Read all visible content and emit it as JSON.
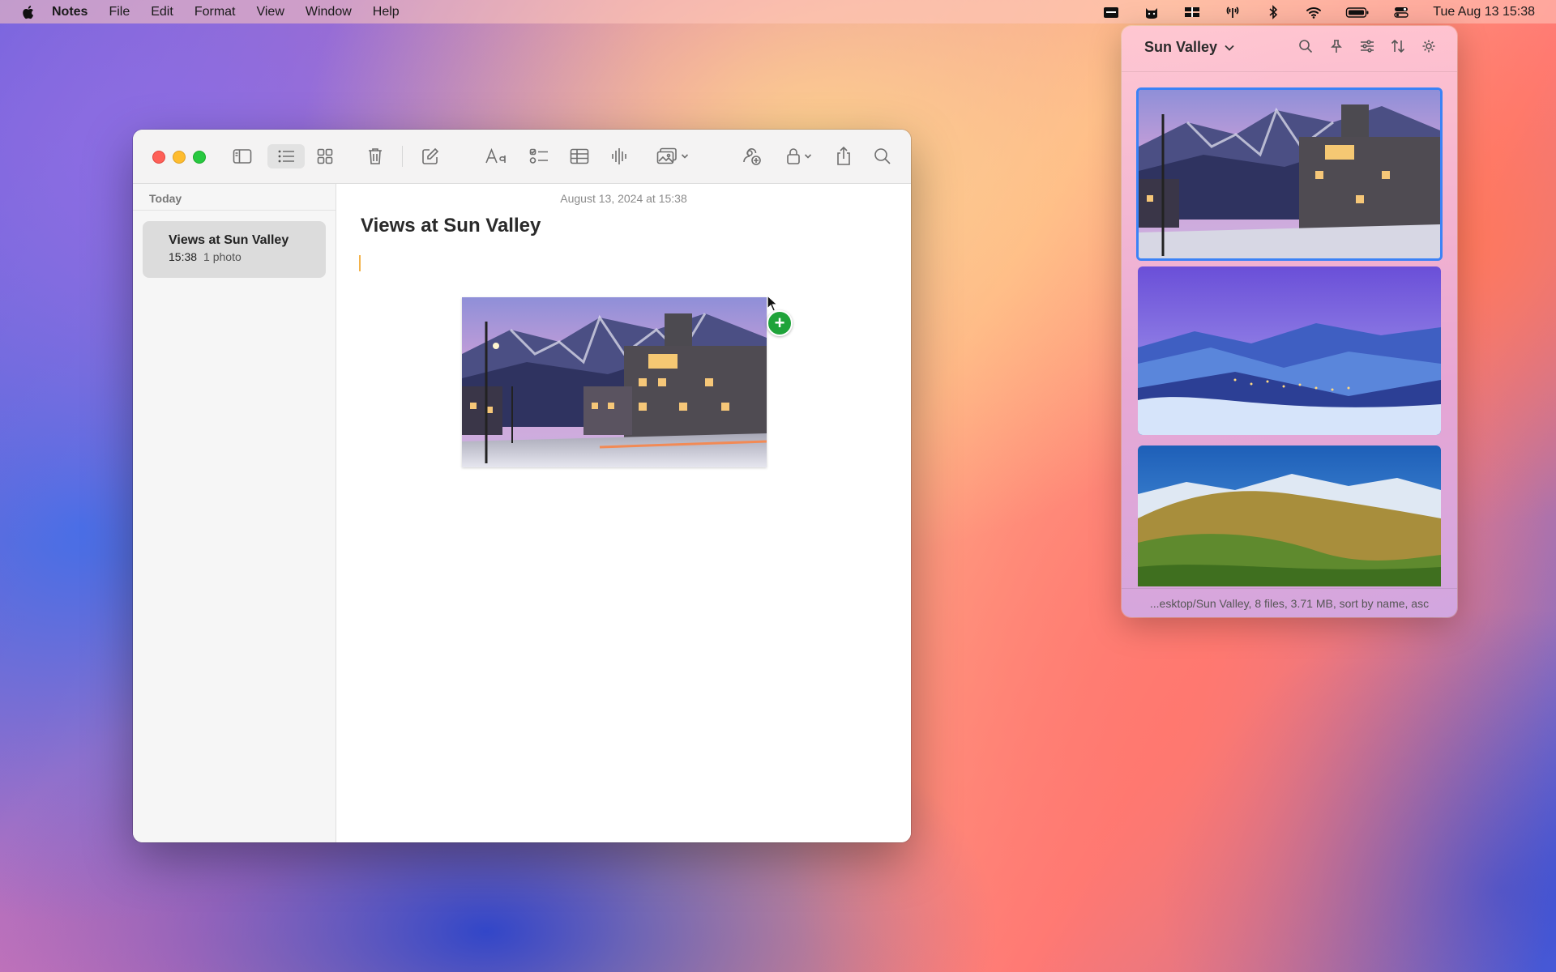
{
  "menubar": {
    "app": "Notes",
    "items": [
      "File",
      "Edit",
      "Format",
      "View",
      "Window",
      "Help"
    ],
    "clock": "Tue Aug 13  15:38"
  },
  "window": {
    "sidebar": {
      "section": "Today",
      "notes": [
        {
          "title": "Views at Sun Valley",
          "time": "15:38",
          "meta": "1 photo"
        }
      ]
    },
    "editor": {
      "date": "August 13, 2024 at 15:38",
      "title": "Views at Sun Valley"
    }
  },
  "panel": {
    "title": "Sun Valley",
    "footer": "...esktop/Sun Valley, 8 files, 3.71 MB, sort by name, asc"
  },
  "colors": {
    "selection_border": "#3b82f6",
    "drop_badge": "#1fa33a",
    "caret": "#f3b24a"
  }
}
